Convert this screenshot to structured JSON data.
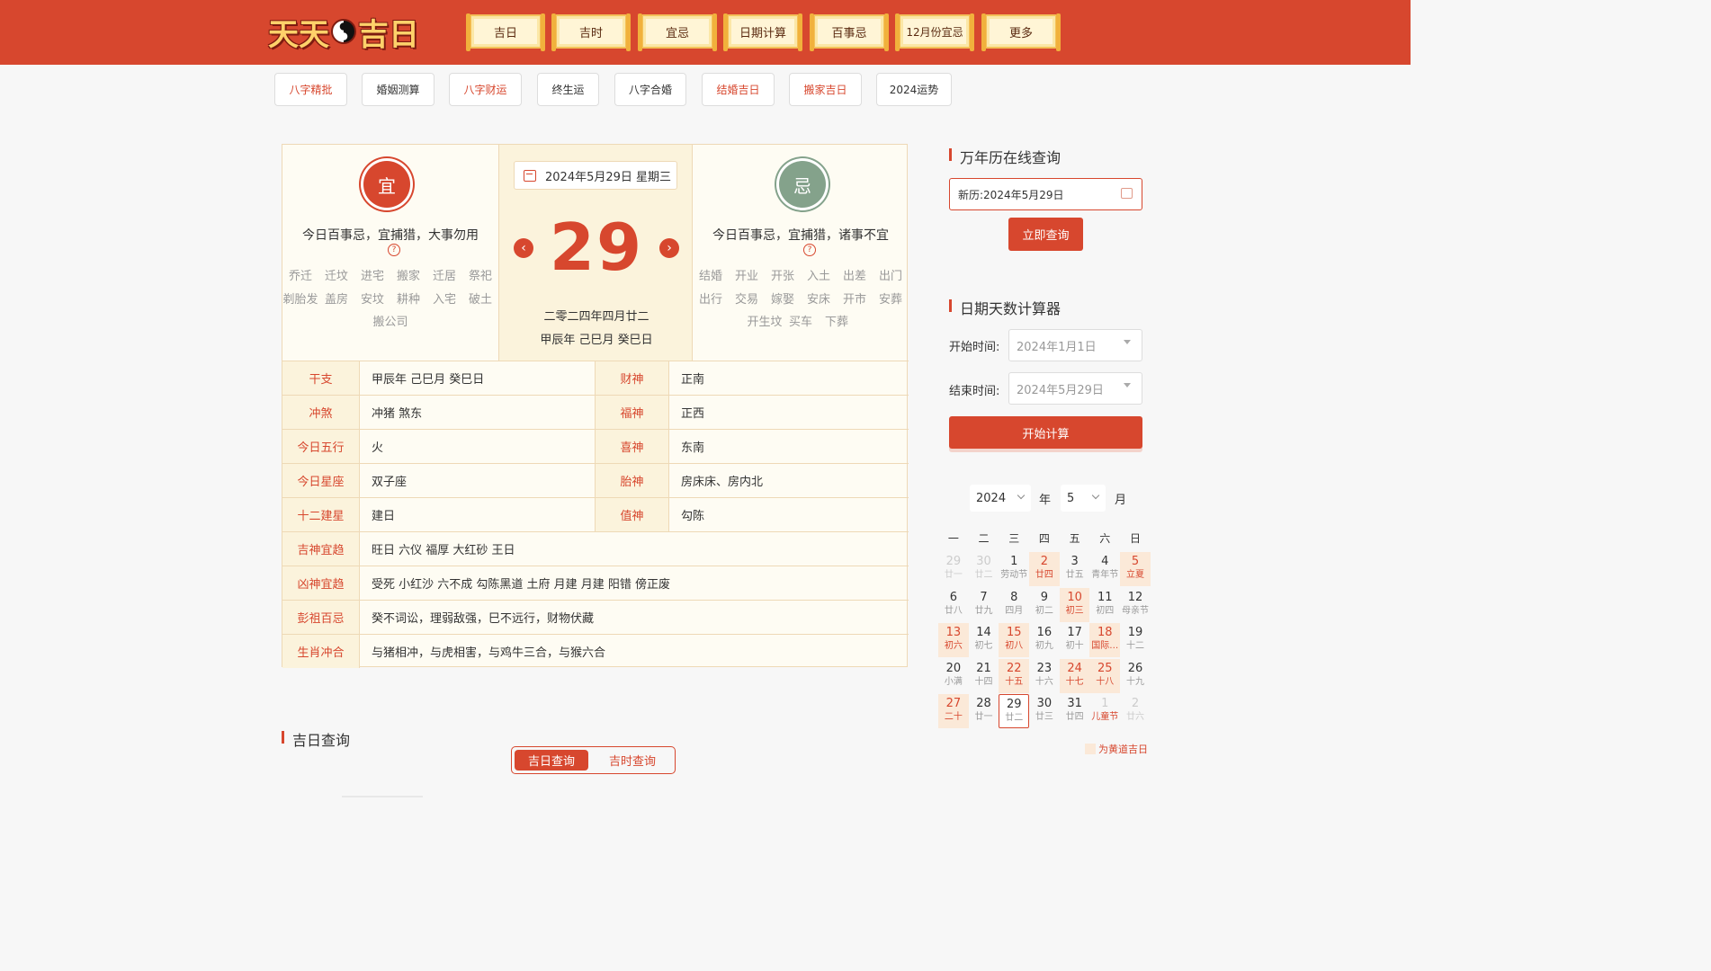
{
  "header": {
    "logo_text_a": "天天",
    "logo_text_b": "吉日",
    "nav": [
      "吉日",
      "吉时",
      "宜忌",
      "日期计算",
      "百事忌",
      "12月份宜忌",
      "更多"
    ]
  },
  "tags": [
    "八字精批",
    "婚姻测算",
    "八字财运",
    "终生运",
    "八字合婚",
    "结婚吉日",
    "搬家吉日",
    "2024运势"
  ],
  "today": {
    "yi_icon": "宜",
    "ji_icon": "忌",
    "yi_summary": "今日百事忌，宜捕猎，大事勿用",
    "ji_summary": "今日百事忌，宜捕猎，诸事不宜",
    "help_mark": "?",
    "yi_items": [
      "乔迁",
      "迁坟",
      "进宅",
      "搬家",
      "迁居",
      "祭祀",
      "剃胎发",
      "盖房",
      "安坟",
      "耕种",
      "入宅",
      "破土",
      "搬公司"
    ],
    "ji_items": [
      "结婚",
      "开业",
      "开张",
      "入土",
      "出差",
      "出门",
      "出行",
      "交易",
      "嫁娶",
      "安床",
      "开市",
      "安葬",
      "开生坟",
      "买车",
      "下葬"
    ],
    "date_label": "2024年5月29日 星期三",
    "day": "29",
    "prev": "‹",
    "next": "›",
    "lunar_line1": "二零二四年四月廿二",
    "lunar_line2": "甲辰年 己巳月 癸巳日"
  },
  "info_half": [
    {
      "l1": "干支",
      "v1": "甲辰年 己巳月 癸巳日",
      "l2": "财神",
      "v2": "正南"
    },
    {
      "l1": "冲煞",
      "v1": "冲猪 煞东",
      "l2": "福神",
      "v2": "正西"
    },
    {
      "l1": "今日五行",
      "v1": "火",
      "l2": "喜神",
      "v2": "东南"
    },
    {
      "l1": "今日星座",
      "v1": "双子座",
      "l2": "胎神",
      "v2": "房床床、房内北"
    },
    {
      "l1": "十二建星",
      "v1": "建日",
      "l2": "值神",
      "v2": "勾陈"
    }
  ],
  "info_full": [
    {
      "l": "吉神宜趋",
      "v": "旺日 六仪 福厚 大红砂 王日"
    },
    {
      "l": "凶神宜趋",
      "v": "受死 小红沙 六不成 勾陈黑道 土府 月建 月建 阳错 傍正废"
    },
    {
      "l": "彭祖百忌",
      "v": "癸不词讼，理弱敌强，巳不远行，财物伏藏"
    },
    {
      "l": "生肖冲合",
      "v": "与猪相冲，与虎相害，与鸡牛三合，与猴六合"
    }
  ],
  "jiri": {
    "title": "吉日查询",
    "tab_on": "吉日查询",
    "tab_off": "吉时查询"
  },
  "sidebar": {
    "wannianli_title": "万年历在线查询",
    "search_value": "新历:2024年5月29日",
    "query_btn": "立即查询",
    "calc_title": "日期天数计算器",
    "start_label": "开始时间:",
    "start_value": "2024年1月1日",
    "end_label": "结束时间:",
    "end_value": "2024年5月29日",
    "calc_btn": "开始计算",
    "year": "2024",
    "year_unit": "年",
    "month": "5",
    "month_unit": "月",
    "weekdays": [
      "一",
      "二",
      "三",
      "四",
      "五",
      "六",
      "日"
    ],
    "legend": "为黄道吉日"
  },
  "calendar": [
    [
      {
        "d": "29",
        "l": "廿一",
        "t": "other"
      },
      {
        "d": "30",
        "l": "廿二",
        "t": "other"
      },
      {
        "d": "1",
        "l": "劳动节",
        "t": ""
      },
      {
        "d": "2",
        "l": "廿四",
        "t": "good"
      },
      {
        "d": "3",
        "l": "廿五",
        "t": ""
      },
      {
        "d": "4",
        "l": "青年节",
        "t": ""
      },
      {
        "d": "5",
        "l": "立夏",
        "t": "good"
      }
    ],
    [
      {
        "d": "6",
        "l": "廿八",
        "t": ""
      },
      {
        "d": "7",
        "l": "廿九",
        "t": ""
      },
      {
        "d": "8",
        "l": "四月",
        "t": ""
      },
      {
        "d": "9",
        "l": "初二",
        "t": ""
      },
      {
        "d": "10",
        "l": "初三",
        "t": "good"
      },
      {
        "d": "11",
        "l": "初四",
        "t": ""
      },
      {
        "d": "12",
        "l": "母亲节",
        "t": ""
      }
    ],
    [
      {
        "d": "13",
        "l": "初六",
        "t": "good"
      },
      {
        "d": "14",
        "l": "初七",
        "t": ""
      },
      {
        "d": "15",
        "l": "初八",
        "t": "good"
      },
      {
        "d": "16",
        "l": "初九",
        "t": ""
      },
      {
        "d": "17",
        "l": "初十",
        "t": ""
      },
      {
        "d": "18",
        "l": "国际…",
        "t": "good"
      },
      {
        "d": "19",
        "l": "十二",
        "t": ""
      }
    ],
    [
      {
        "d": "20",
        "l": "小满",
        "t": ""
      },
      {
        "d": "21",
        "l": "十四",
        "t": ""
      },
      {
        "d": "22",
        "l": "十五",
        "t": "good"
      },
      {
        "d": "23",
        "l": "十六",
        "t": ""
      },
      {
        "d": "24",
        "l": "十七",
        "t": "good"
      },
      {
        "d": "25",
        "l": "十八",
        "t": "good"
      },
      {
        "d": "26",
        "l": "十九",
        "t": ""
      }
    ],
    [
      {
        "d": "27",
        "l": "二十",
        "t": "good"
      },
      {
        "d": "28",
        "l": "廿一",
        "t": ""
      },
      {
        "d": "29",
        "l": "廿二",
        "t": "today"
      },
      {
        "d": "30",
        "l": "廿三",
        "t": ""
      },
      {
        "d": "31",
        "l": "廿四",
        "t": ""
      },
      {
        "d": "1",
        "l": "儿童节",
        "t": "other red-l"
      },
      {
        "d": "2",
        "l": "廿六",
        "t": "other"
      }
    ]
  ]
}
